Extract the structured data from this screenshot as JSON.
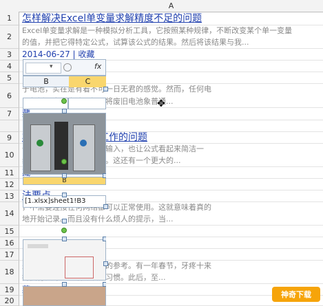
{
  "column_header": "A",
  "rows": [
    {
      "num": "1",
      "kind": "title",
      "text": "怎样解决Excel单变量求解精度不足的问题"
    },
    {
      "num": "2",
      "kind": "desc",
      "text": "Excel单变量求解是一种模拟分析工具，它按照某种规律，不断改变某个单一变量"
    },
    {
      "num": "",
      "kind": "desc",
      "text": "的值，并把它得特定公式，试算该公式的结果。然后将该结果与我..."
    },
    {
      "num": "3",
      "kind": "date",
      "text": "2014-06-27 | 收藏"
    },
    {
      "num": "4",
      "kind": "blank",
      "text": ""
    },
    {
      "num": "5",
      "kind": "blank",
      "text": ""
    },
    {
      "num": "",
      "kind": "desc",
      "text": "于电池，实在是有着不可一日无君的感觉。然而，任何电"
    },
    {
      "num": "6",
      "kind": "desc",
      "text": "，包括可充电电池。如果将废旧电池象普通..."
    },
    {
      "num": "7",
      "kind": "date",
      "text": "藏"
    },
    {
      "num": "9",
      "kind": "title",
      "text": "相对路径不能正常工作的问题"
    },
    {
      "num": "",
      "kind": "desc",
      "text": "作簿中的内容，为了简化输入，也让公式看起来简洁一"
    },
    {
      "num": "10",
      "kind": "desc",
      "text": "绝对路径是个很好的办法。这还有一个更大的..."
    },
    {
      "num": "11",
      "kind": "date",
      "text": "藏"
    },
    {
      "num": "12",
      "kind": "blank",
      "text": ""
    },
    {
      "num": "13",
      "kind": "title",
      "text": "法要点"
    },
    {
      "num": "",
      "kind": "desc",
      "text": "，不需要连接任何网络都可以正常使用。这就意味着真的"
    },
    {
      "num": "14",
      "kind": "desc",
      "text": "地开始记录。而且没有什么烦人的提示，当..."
    },
    {
      "num": "15",
      "kind": "blank",
      "text": ""
    },
    {
      "num": "16",
      "kind": "blank",
      "text": ""
    },
    {
      "num": "17",
      "kind": "blank",
      "text": ""
    },
    {
      "num": "",
      "kind": "desc",
      "text": "处的经验，给您一个有效的参考。有一年春节，牙疼十来"
    },
    {
      "num": "18",
      "kind": "desc",
      "text": "持执行良好的生活与饮食习惯。此后，至..."
    },
    {
      "num": "19",
      "kind": "date",
      "text": "藏"
    },
    {
      "num": "20",
      "kind": "blank",
      "text": ""
    }
  ],
  "embedded": {
    "namebox_value": "▾",
    "fx_label": "fx",
    "col_b": "B",
    "col_c": "C",
    "col_b2": "B",
    "formula_text": "[1.xlsx]sheet1!B3"
  },
  "watermark": "神奇下载",
  "colors": {
    "link": "#1f3fae",
    "desc": "#8a8a8a",
    "accent": "#f6a40a",
    "header_bg": "#f3f3f3"
  }
}
